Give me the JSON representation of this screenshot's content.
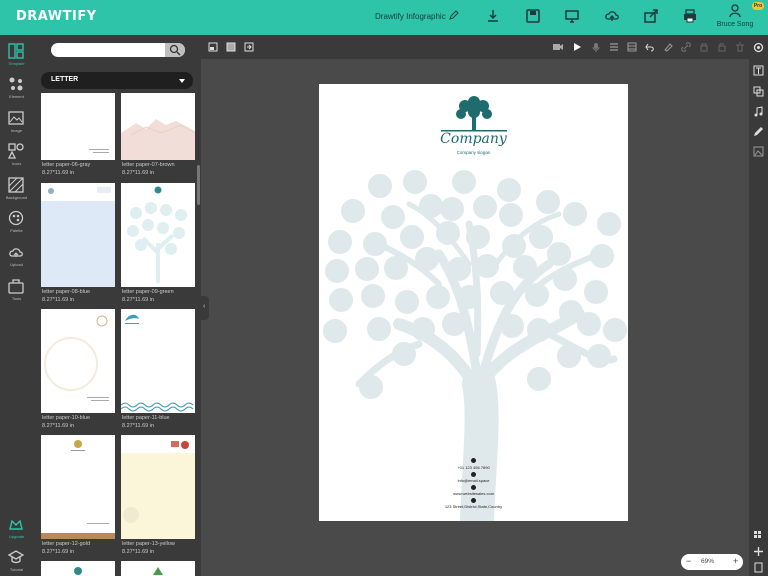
{
  "app": {
    "logo": "DRAWTIFY",
    "doc_title": "Drawtify Infographic",
    "user_name": "Bruce Song",
    "pro_badge": "Pro"
  },
  "toolbar": {
    "icons": [
      "download-icon",
      "save-icon",
      "present-icon",
      "cloud-upload-icon",
      "share-icon",
      "print-icon",
      "user-icon"
    ]
  },
  "left_rail": [
    {
      "label": "Template",
      "icon": "template-icon",
      "active": true
    },
    {
      "label": "Element",
      "icon": "element-icon"
    },
    {
      "label": "Image",
      "icon": "image-icon"
    },
    {
      "label": "Icons",
      "icon": "shapes-icon"
    },
    {
      "label": "Background",
      "icon": "background-icon"
    },
    {
      "label": "Palette",
      "icon": "palette-icon"
    },
    {
      "label": "Upload",
      "icon": "cloud-upload-icon"
    },
    {
      "label": "Tools",
      "icon": "tools-icon"
    },
    {
      "label": "Upgrade",
      "icon": "upgrade-icon"
    },
    {
      "label": "Tutorial",
      "icon": "tutorial-icon"
    }
  ],
  "panel": {
    "search_placeholder": "",
    "category": "LETTER",
    "templates": [
      {
        "name": "letter paper-06-gray",
        "size": "8.27*11.69 in"
      },
      {
        "name": "letter paper-07-brown",
        "size": "8.27*11.69 in"
      },
      {
        "name": "letter paper-08-blue",
        "size": "8.27*11.69 in"
      },
      {
        "name": "letter paper-09-green",
        "size": "8.27*11.69 in"
      },
      {
        "name": "letter paper-10-blue",
        "size": "8.27*11.69 in"
      },
      {
        "name": "letter paper-11-blue",
        "size": "8.27*11.69 in"
      },
      {
        "name": "letter paper-12-gold",
        "size": "8.27*11.69 in"
      },
      {
        "name": "letter paper-13-yellow",
        "size": "8.27*11.69 in"
      }
    ]
  },
  "canvas": {
    "company": "Company",
    "slogan": "Company slogan",
    "phone": "+01 123 456 7890",
    "email": "info@email.space",
    "website": "www.websitesales.com",
    "address": "123 Street,District,State,Country"
  },
  "zoom": {
    "value": "69%",
    "minus": "−",
    "plus": "+"
  },
  "colors": {
    "accent": "#2ec4a9",
    "tree": "#1f6b6e",
    "tree_light": "#dfe8eb"
  }
}
